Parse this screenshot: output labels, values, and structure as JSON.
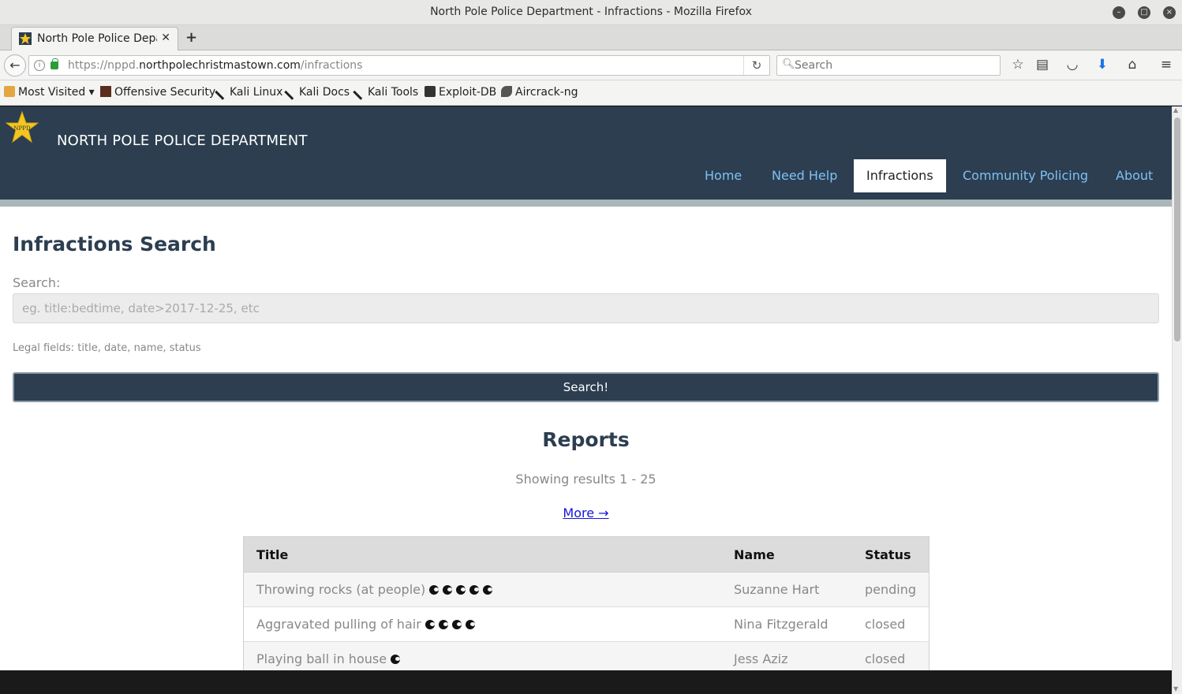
{
  "window": {
    "title": "North Pole Police Department - Infractions - Mozilla Firefox"
  },
  "tab": {
    "title": "North Pole Police Department - Infractions"
  },
  "urlbar": {
    "scheme_prefix": "https://nppd.",
    "domain": "northpolechristmastown.com",
    "path": "/infractions"
  },
  "searchbar": {
    "placeholder": "Search"
  },
  "bookmarks": [
    "Most Visited",
    "Offensive Security",
    "Kali Linux",
    "Kali Docs",
    "Kali Tools",
    "Exploit-DB",
    "Aircrack-ng"
  ],
  "site": {
    "logo_text": "NPPD",
    "brand": "NORTH POLE POLICE DEPARTMENT",
    "nav": [
      "Home",
      "Need Help",
      "Infractions",
      "Community Policing",
      "About"
    ],
    "active_nav": "Infractions"
  },
  "search": {
    "heading": "Infractions Search",
    "label": "Search:",
    "placeholder": "eg. title:bedtime, date>2017-12-25, etc",
    "help": "Legal fields: title, date, name, status",
    "button": "Search!"
  },
  "reports": {
    "heading": "Reports",
    "results_text": "Showing results 1 - 25",
    "more_link": "More →",
    "columns": [
      "Title",
      "Name",
      "Status"
    ],
    "rows": [
      {
        "title": "Throwing rocks (at people)",
        "coal": 5,
        "name": "Suzanne Hart",
        "status": "pending"
      },
      {
        "title": "Aggravated pulling of hair",
        "coal": 4,
        "name": "Nina Fitzgerald",
        "status": "closed"
      },
      {
        "title": "Playing ball in house",
        "coal": 1,
        "name": "Jess Aziz",
        "status": "closed"
      }
    ]
  },
  "colors": {
    "header_bg": "#2c3e50",
    "nav_link": "#7fc0f4",
    "accent": "#2c3e50"
  }
}
